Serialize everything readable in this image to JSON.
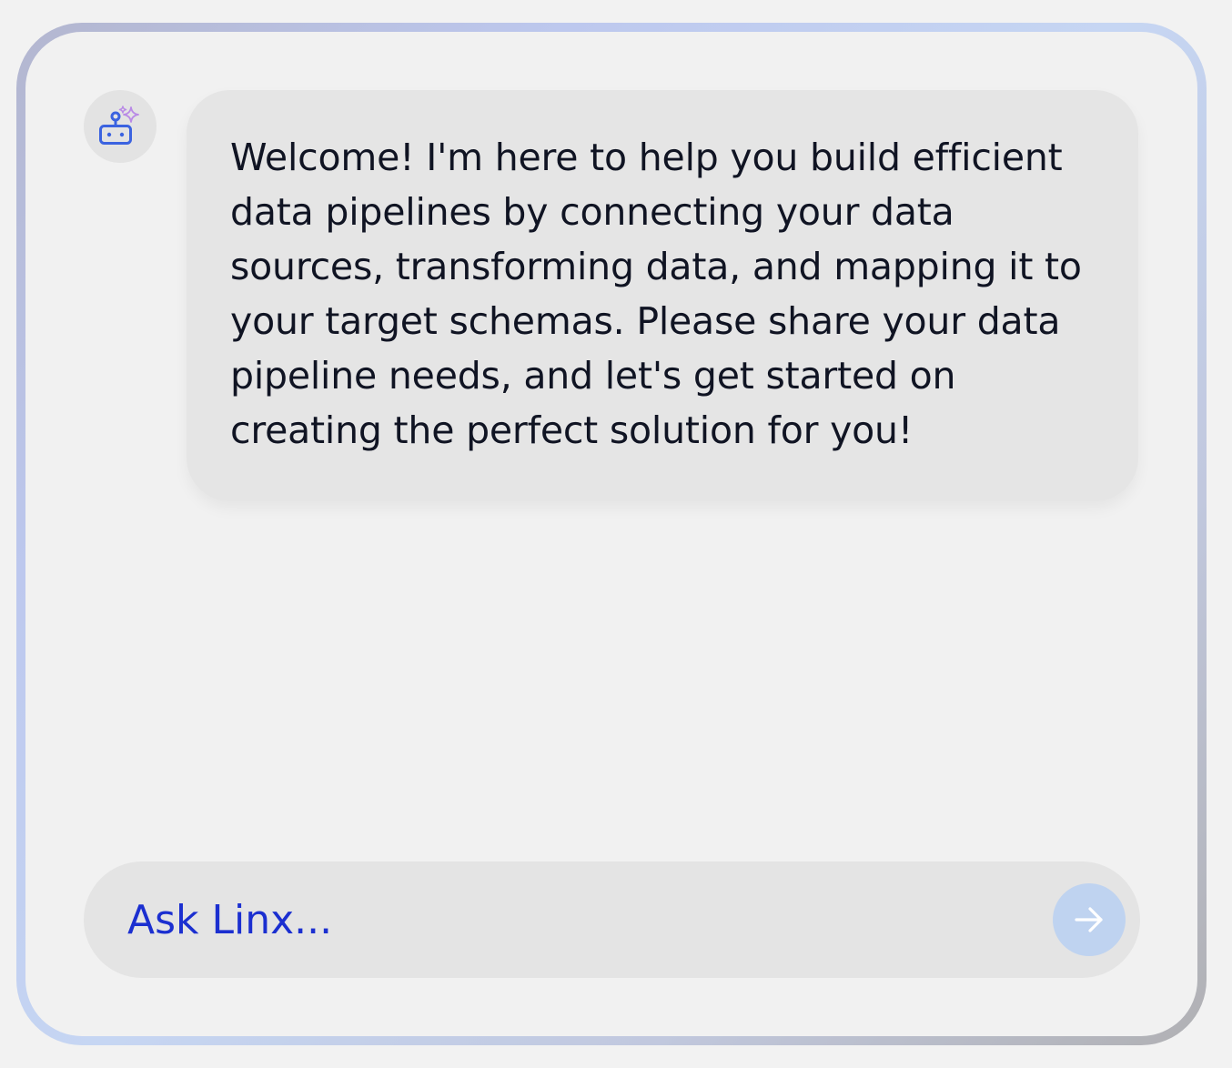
{
  "chat": {
    "assistant_avatar_icon": "robot-sparkle-icon",
    "messages": [
      {
        "role": "assistant",
        "text": "Welcome! I'm here to help you build efficient data pipelines by connecting your data sources, transforming data, and mapping it to your target schemas. Please share your data pipeline needs, and let's get started on creating the perfect solution for you!"
      }
    ]
  },
  "composer": {
    "placeholder": "Ask Linx...",
    "value": "",
    "send_icon": "arrow-right-icon"
  },
  "colors": {
    "accent": "#1b2fd0",
    "send_button": "#bfd3f0",
    "bubble": "#e5e5e5",
    "background": "#f1f1f1"
  }
}
